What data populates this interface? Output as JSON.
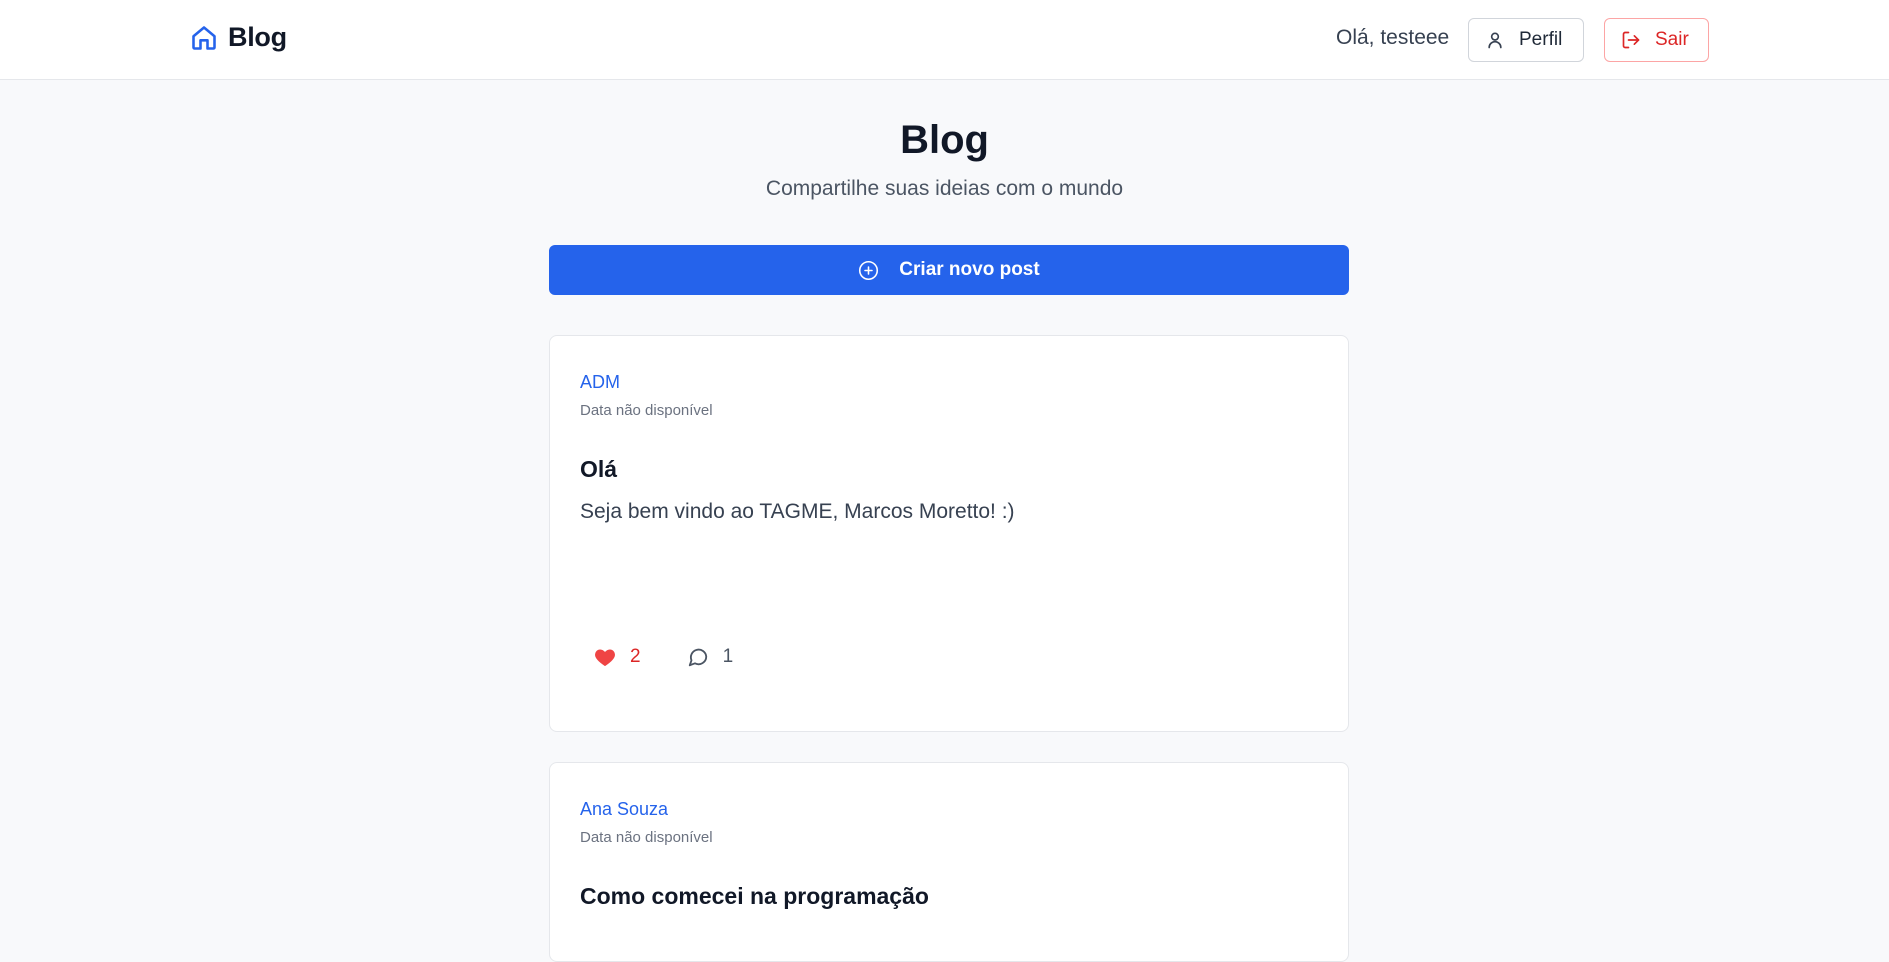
{
  "header": {
    "brand": "Blog",
    "greeting": "Olá, testeee",
    "profile_label": "Perfil",
    "logout_label": "Sair"
  },
  "hero": {
    "title": "Blog",
    "subtitle": "Compartilhe suas ideias com o mundo",
    "create_label": "Criar novo post"
  },
  "posts": [
    {
      "author": "ADM",
      "date": "Data não disponível",
      "title": "Olá",
      "content": "Seja bem vindo ao TAGME, Marcos Moretto! :)",
      "likes": "2",
      "comments": "1",
      "liked": true
    },
    {
      "author": "Ana Souza",
      "date": "Data não disponível",
      "title": "Como comecei na programação"
    }
  ],
  "colors": {
    "primary": "#2563eb",
    "danger": "#dc2626",
    "background": "#f8f9fb"
  },
  "icons": {
    "brand": "home-icon",
    "profile": "user-icon",
    "logout": "log-out-icon",
    "create": "plus-circle-icon",
    "like": "heart-icon",
    "comment": "message-circle-icon"
  }
}
